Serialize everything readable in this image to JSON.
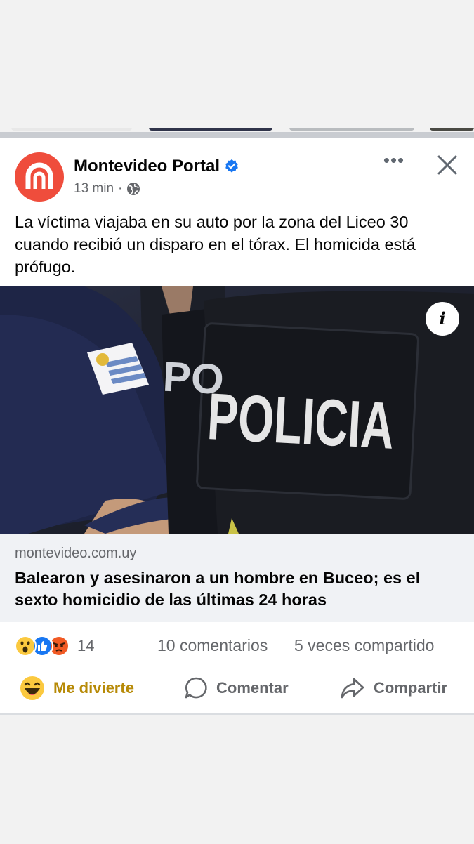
{
  "post": {
    "page_name": "Montevideo Portal",
    "time": "13 min",
    "time_separator": "·",
    "audience_icon": "globe-icon",
    "text": "La víctima viajaba en su auto por la zona del Liceo 30 cuando recibió un disparo en el tórax. El homicida está prófugo.",
    "more_label": "•••"
  },
  "image": {
    "info_label": "i",
    "patch_text": "POLICIA",
    "patch_text_back": "PO"
  },
  "link": {
    "domain": "montevideo.com.uy",
    "title": "Balearon y asesinaron a un hombre en Buceo; es el sexto homicidio de las últimas 24 horas"
  },
  "engagement": {
    "reaction_count": "14",
    "comments": "10 comentarios",
    "shares": "5 veces compartido"
  },
  "actions": {
    "react_label": "Me divierte",
    "comment_label": "Comentar",
    "share_label": "Compartir"
  },
  "colors": {
    "brand_red": "#ef4d3c",
    "verified_blue": "#1877f2",
    "react_gold": "#b78a07",
    "text_secondary": "#65676b"
  }
}
